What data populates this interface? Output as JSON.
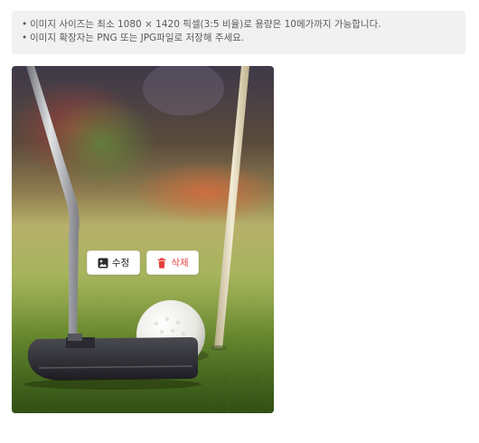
{
  "notice": {
    "bullet": "•",
    "lines": [
      "이미지 사이즈는 최소 1080 × 1420 픽셀(3:5 비율)로 용량은 10메가까지 가능합니다.",
      "이미지 확장자는 PNG 또는 JPG파일로 저장해 주세요."
    ]
  },
  "photo": {
    "subject": "golf putter and ball on green"
  },
  "actions": {
    "edit": {
      "label": "수정",
      "icon": "image-icon"
    },
    "delete": {
      "label": "삭제",
      "icon": "trash-icon",
      "color": "#e5413d"
    }
  }
}
